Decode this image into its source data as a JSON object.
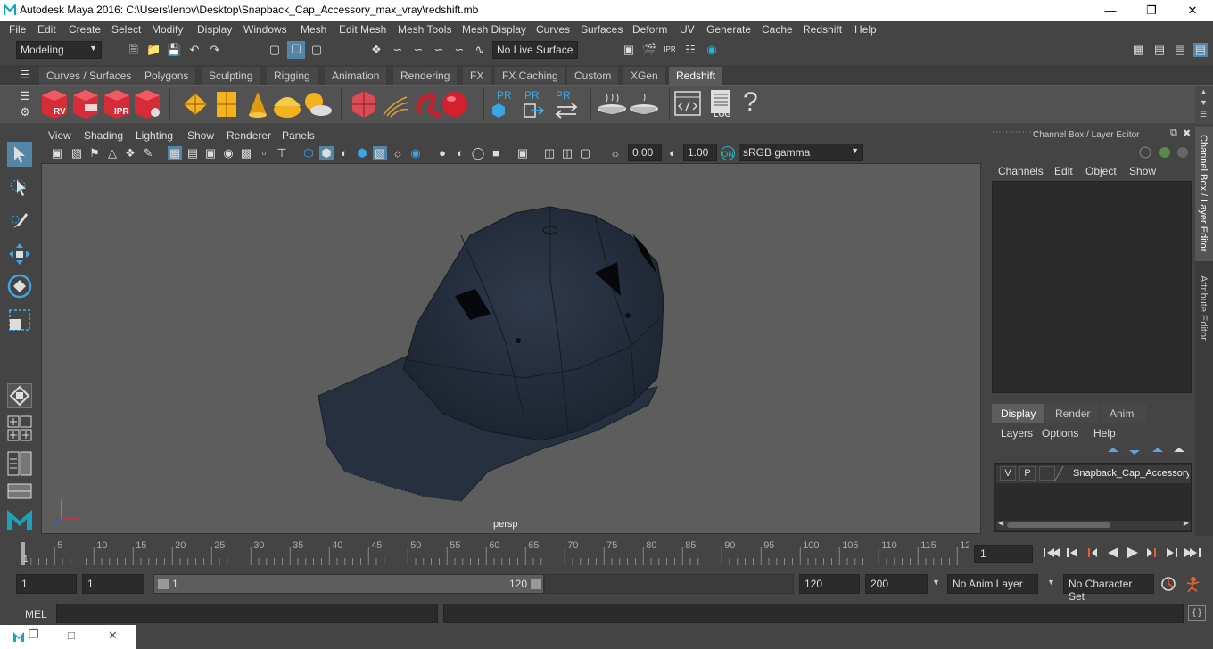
{
  "window": {
    "title": "Autodesk Maya 2016: C:\\Users\\lenov\\Desktop\\Snapback_Cap_Accessory_max_vray\\redshift.mb"
  },
  "menu": [
    "File",
    "Edit",
    "Create",
    "Select",
    "Modify",
    "Display",
    "Windows",
    "Mesh",
    "Edit Mesh",
    "Mesh Tools",
    "Mesh Display",
    "Curves",
    "Surfaces",
    "Deform",
    "UV",
    "Generate",
    "Cache",
    "Redshift",
    "Help"
  ],
  "status": {
    "mode": "Modeling",
    "live_surface": "No Live Surface"
  },
  "shelf_tabs": [
    "Curves / Surfaces",
    "Polygons",
    "Sculpting",
    "Rigging",
    "Animation",
    "Rendering",
    "FX",
    "FX Caching",
    "Custom",
    "XGen",
    "Redshift"
  ],
  "shelf_active": "Redshift",
  "shelf_labels": {
    "rv": "RV",
    "ipr": "IPR",
    "pr1": "PR",
    "pr2": "PR",
    "pr3": "PR",
    "log": "LOG",
    "help": "?"
  },
  "viewport": {
    "menu": [
      "View",
      "Shading",
      "Lighting",
      "Show",
      "Renderer",
      "Panels"
    ],
    "exposure": "0.00",
    "gamma": "1.00",
    "colorspace": "sRGB gamma",
    "camera": "persp"
  },
  "channel_box": {
    "title": "Channel Box / Layer Editor",
    "menu": [
      "Channels",
      "Edit",
      "Object",
      "Show"
    ]
  },
  "layer_editor": {
    "tabs": [
      "Display",
      "Render",
      "Anim"
    ],
    "active_tab": "Display",
    "menu": [
      "Layers",
      "Options",
      "Help"
    ],
    "layer": {
      "v": "V",
      "p": "P",
      "name": "Snapback_Cap_Accessory"
    }
  },
  "side_tabs": [
    "Channel Box / Layer Editor",
    "Attribute Editor"
  ],
  "timeline": {
    "ticks": [
      "5",
      "10",
      "15",
      "20",
      "25",
      "30",
      "35",
      "40",
      "45",
      "50",
      "55",
      "60",
      "65",
      "70",
      "75",
      "80",
      "85",
      "90",
      "95",
      "100",
      "105",
      "110",
      "115",
      "12"
    ],
    "start_marker": "1",
    "current_frame": "1"
  },
  "range": {
    "start": "1",
    "start2": "1",
    "slider_start": "1",
    "slider_end": "120",
    "end": "120",
    "end2": "200",
    "anim_layer": "No Anim Layer",
    "char_set": "No Character Set"
  },
  "cmd": {
    "label": "MEL"
  }
}
